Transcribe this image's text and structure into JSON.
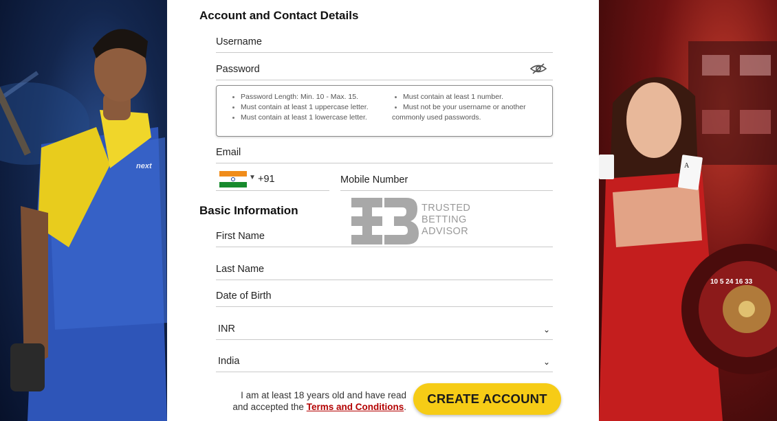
{
  "account_section": {
    "title": "Account and Contact Details",
    "username_label": "Username",
    "password_label": "Password",
    "password_rules_left": [
      "Password Length: Min. 10 - Max. 15.",
      "Must contain at least 1 uppercase letter.",
      "Must contain at least 1 lowercase letter."
    ],
    "password_rules_right": [
      "Must contain at least 1 number.",
      "Must not be your username or another",
      "commonly used passwords."
    ],
    "email_label": "Email",
    "country_code": "+91",
    "mobile_label": "Mobile Number"
  },
  "basic_section": {
    "title": "Basic Information",
    "first_name_label": "First Name",
    "last_name_label": "Last Name",
    "dob_label": "Date of Birth",
    "currency_value": "INR",
    "country_value": "India"
  },
  "footer": {
    "terms_prefix": "I am at least 18 years old and have read and accepted the",
    "terms_link": "Terms and Conditions",
    "terms_suffix": ".",
    "create_button": "CREATE ACCOUNT"
  },
  "watermark": {
    "line1": "TRUSTED",
    "line2": "BETTING",
    "line3": "ADVISOR"
  },
  "colors": {
    "accent": "#f6cc16",
    "link": "#b30000"
  },
  "icons": {
    "password_toggle": "eye-slash-icon",
    "flag": "india-flag-icon",
    "chevron": "chevron-down-icon"
  }
}
